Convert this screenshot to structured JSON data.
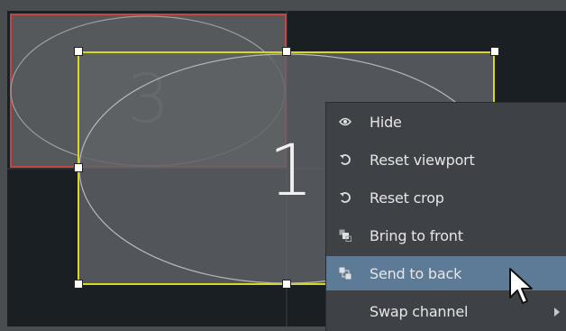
{
  "viewports": {
    "back": {
      "number": "3",
      "border_color": "#c74444",
      "selected": false
    },
    "front": {
      "number": "1",
      "border_color": "#d8d820",
      "selected": true
    }
  },
  "context_menu": {
    "items": [
      {
        "label": "Hide",
        "icon": "eye-icon"
      },
      {
        "label": "Reset viewport",
        "icon": "reset-icon"
      },
      {
        "label": "Reset crop",
        "icon": "reset-icon"
      },
      {
        "label": "Bring to front",
        "icon": "bring-to-front-icon"
      },
      {
        "label": "Send to back",
        "icon": "send-to-back-icon",
        "highlighted": true
      },
      {
        "label": "Swap channel",
        "icon": "",
        "has_submenu": true
      }
    ],
    "highlight_color": "#5d7a97"
  }
}
